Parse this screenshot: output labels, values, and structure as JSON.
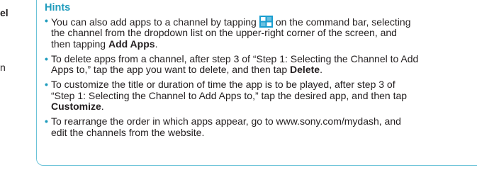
{
  "margin": {
    "top_fragment": "el",
    "mid_fragment": "n"
  },
  "hints": {
    "title": "Hints",
    "bullet": "•",
    "items": [
      {
        "line1_a": "You can also add apps to a channel by tapping",
        "icon": "command-bar-grid-icon",
        "line1_b": "on the command bar, selecting",
        "line2": "the channel from the dropdown list on the upper-right corner of the screen, and",
        "line3_a": "then tapping ",
        "line3_bold": "Add Apps",
        "line3_b": "."
      },
      {
        "line1": "To delete apps from a channel, after step 3 of “Step 1: Selecting the Channel to Add",
        "line2_a": "Apps to,” tap the app you want to delete, and then tap ",
        "line2_bold": "Delete",
        "line2_b": "."
      },
      {
        "line1": "To customize the title or duration of time the app is to be played, after step 3 of",
        "line2": "“Step 1: Selecting the Channel to Add Apps to,” tap the desired app, and then tap",
        "line3_bold": "Customize",
        "line3_b": "."
      },
      {
        "line1": "To rearrange the order in which apps appear, go to www.sony.com/mydash, and",
        "line2": "edit the channels from the website."
      }
    ]
  },
  "colors": {
    "accent": "#1f9cbd",
    "border": "#6cc3d8",
    "icon_blue": "#1a9ed0",
    "text": "#231f20"
  }
}
